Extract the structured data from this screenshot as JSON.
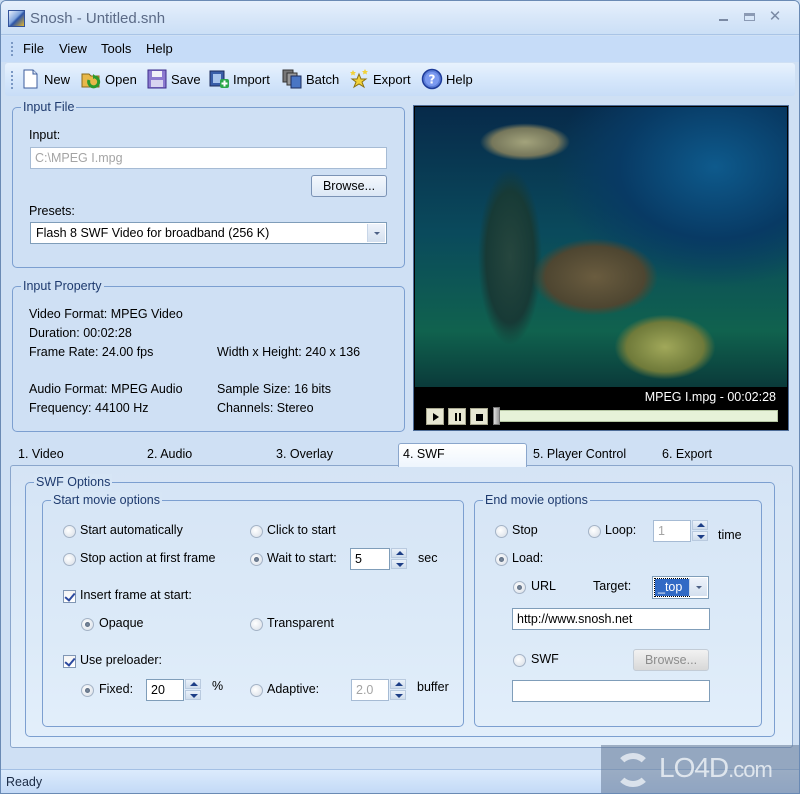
{
  "window": {
    "title": "Snosh - Untitled.snh",
    "controls": {
      "minimize": "minimize",
      "maximize": "maximize",
      "close": "close"
    }
  },
  "menu": [
    {
      "label": "File",
      "accel": "F"
    },
    {
      "label": "View",
      "accel": "V"
    },
    {
      "label": "Tools",
      "accel": "T"
    },
    {
      "label": "Help",
      "accel": "H"
    }
  ],
  "toolbar": [
    {
      "label": "New",
      "icon": "new-document-icon"
    },
    {
      "label": "Open",
      "icon": "open-folder-icon"
    },
    {
      "label": "Save",
      "icon": "floppy-disk-icon"
    },
    {
      "label": "Import",
      "icon": "import-film-icon"
    },
    {
      "label": "Batch",
      "icon": "batch-films-icon"
    },
    {
      "label": "Export",
      "icon": "export-stars-icon"
    },
    {
      "label": "Help",
      "icon": "help-icon"
    }
  ],
  "input_file": {
    "group_label": "Input File",
    "input_label": "Input:",
    "input_value": "C:\\MPEG I.mpg",
    "browse_label": "Browse...",
    "presets_label": "Presets:",
    "preset_selected": "Flash 8 SWF Video for broadband (256 K)"
  },
  "input_property": {
    "group_label": "Input Property",
    "video_format": "Video Format: MPEG Video",
    "duration": "Duration: 00:02:28",
    "frame_rate": "Frame Rate: 24.00 fps",
    "dimensions": "Width x Height: 240 x 136",
    "audio_format": "Audio Format: MPEG Audio",
    "sample_size": "Sample Size: 16 bits",
    "frequency": "Frequency: 44100 Hz",
    "channels": "Channels: Stereo"
  },
  "preview": {
    "caption": "MPEG I.mpg - 00:02:28",
    "seek_progress": 0.0
  },
  "tabs": [
    {
      "label": "1. Video",
      "active": false
    },
    {
      "label": "2. Audio",
      "active": false
    },
    {
      "label": "3. Overlay",
      "active": false
    },
    {
      "label": "4. SWF",
      "active": true
    },
    {
      "label": "5. Player Control",
      "active": false
    },
    {
      "label": "6. Export",
      "active": false
    }
  ],
  "swf": {
    "group_label": "SWF Options",
    "start": {
      "group_label": "Start movie options",
      "start_automatically": "Start automatically",
      "click_to_start": "Click to start",
      "stop_first_frame": "Stop action at first frame",
      "wait_to_start": "Wait to start:",
      "wait_value": "5",
      "wait_unit": "sec",
      "selected": "wait_to_start",
      "insert_frame": "Insert frame at start:",
      "insert_frame_checked": true,
      "opaque": "Opaque",
      "transparent": "Transparent",
      "frame_mode": "opaque",
      "use_preloader": "Use preloader:",
      "use_preloader_checked": true,
      "fixed": "Fixed:",
      "fixed_value": "20",
      "fixed_unit": "%",
      "adaptive": "Adaptive:",
      "adaptive_value": "2.0",
      "adaptive_unit": "buffer",
      "preloader_mode": "fixed"
    },
    "end": {
      "group_label": "End movie options",
      "stop": "Stop",
      "loop": "Loop:",
      "loop_value": "1",
      "loop_unit": "time",
      "load": "Load:",
      "selected": "load",
      "url": "URL",
      "target_label": "Target:",
      "target_value": "_top",
      "url_value": "http://www.snosh.net",
      "swf": "SWF",
      "load_mode": "url",
      "browse_label": "Browse...",
      "swf_value": ""
    }
  },
  "status": {
    "text": "Ready"
  },
  "watermark": {
    "text": "LO4D",
    "suffix": ".com"
  }
}
